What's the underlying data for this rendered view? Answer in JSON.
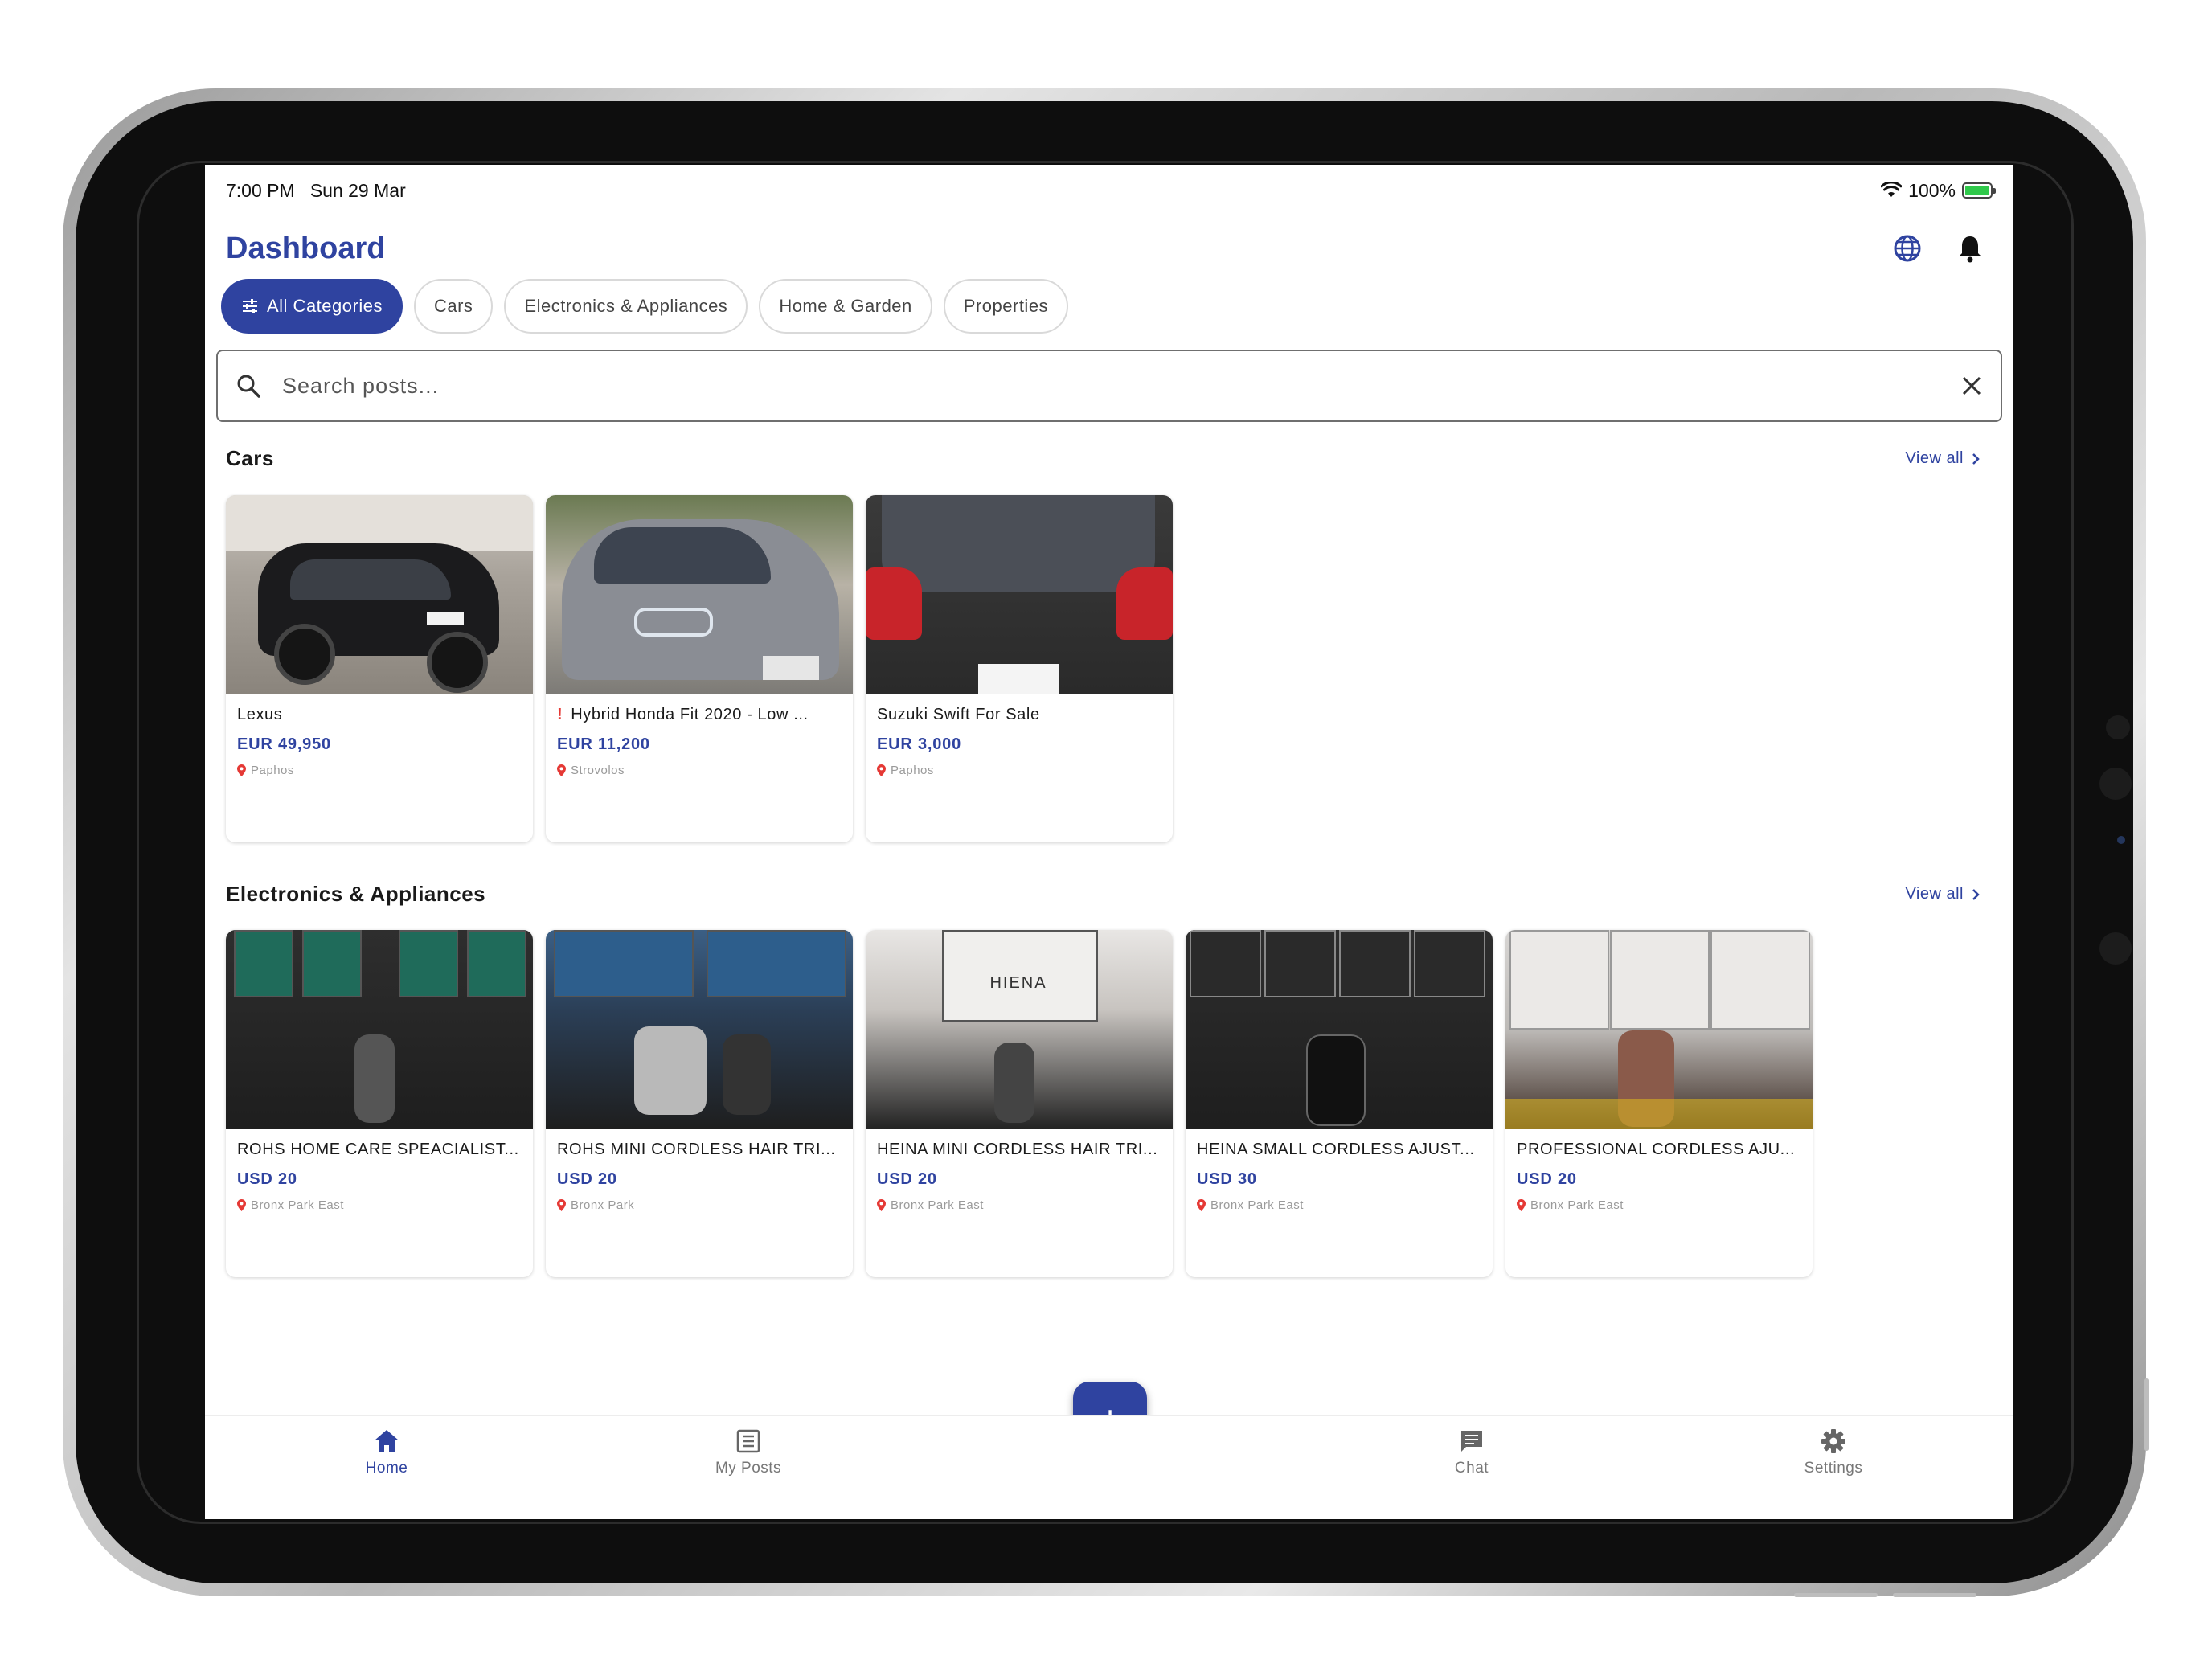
{
  "status": {
    "time": "7:00 PM",
    "date": "Sun 29 Mar",
    "battery": "100%"
  },
  "header": {
    "title": "Dashboard"
  },
  "chips": [
    {
      "label": "All Categories",
      "active": true
    },
    {
      "label": "Cars"
    },
    {
      "label": "Electronics & Appliances"
    },
    {
      "label": "Home & Garden"
    },
    {
      "label": "Properties"
    }
  ],
  "search": {
    "placeholder": "Search posts..."
  },
  "sections": [
    {
      "title": "Cars",
      "view_all": "View all",
      "items": [
        {
          "title": "Lexus",
          "price": "EUR 49,950",
          "location": "Paphos"
        },
        {
          "title": "Hybrid Honda Fit 2020 - Low ...",
          "price": "EUR 11,200",
          "location": "Strovolos",
          "alert": "!"
        },
        {
          "title": "Suzuki Swift For Sale",
          "price": "EUR 3,000",
          "location": "Paphos"
        }
      ]
    },
    {
      "title": "Electronics & Appliances",
      "view_all": "View all",
      "items": [
        {
          "title": "ROHS HOME CARE SPEACIALIST...",
          "price": "USD 20",
          "location": "Bronx Park East"
        },
        {
          "title": "ROHS MINI CORDLESS HAIR TRI...",
          "price": "USD 20",
          "location": "Bronx Park"
        },
        {
          "title": "HEINA MINI CORDLESS HAIR TRI...",
          "price": "USD 20",
          "location": "Bronx Park East"
        },
        {
          "title": "HEINA SMALL CORDLESS AJUST...",
          "price": "USD 30",
          "location": "Bronx Park East"
        },
        {
          "title": "PROFESSIONAL CORDLESS AJU...",
          "price": "USD 20",
          "location": "Bronx Park East"
        }
      ]
    }
  ],
  "product_marks": {
    "heina_box": "HIENA"
  },
  "nav": [
    {
      "label": "Home",
      "icon": "home-icon",
      "active": true
    },
    {
      "label": "My Posts",
      "icon": "list-icon"
    },
    {
      "label": "Chat",
      "icon": "chat-icon"
    },
    {
      "label": "Settings",
      "icon": "gear-icon"
    }
  ],
  "fab": {
    "label": "+"
  },
  "colors": {
    "primary": "#2f43a0",
    "location_pin": "#e53935",
    "battery": "#30c94b"
  }
}
